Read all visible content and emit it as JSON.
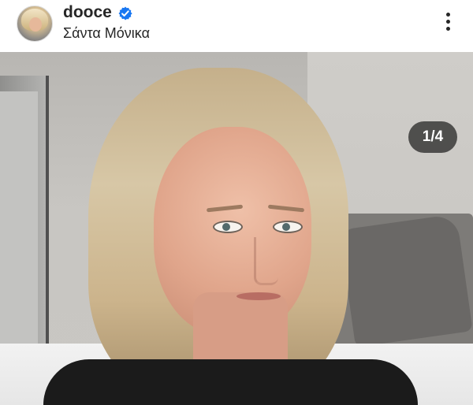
{
  "post": {
    "username": "dooce",
    "location": "Σάντα Μόνικα",
    "carousel_indicator": "1/4"
  },
  "icons": {
    "verified": "verified-badge-icon",
    "more": "more-options-icon"
  },
  "colors": {
    "verified_blue": "#1877f2",
    "text": "#262626"
  }
}
